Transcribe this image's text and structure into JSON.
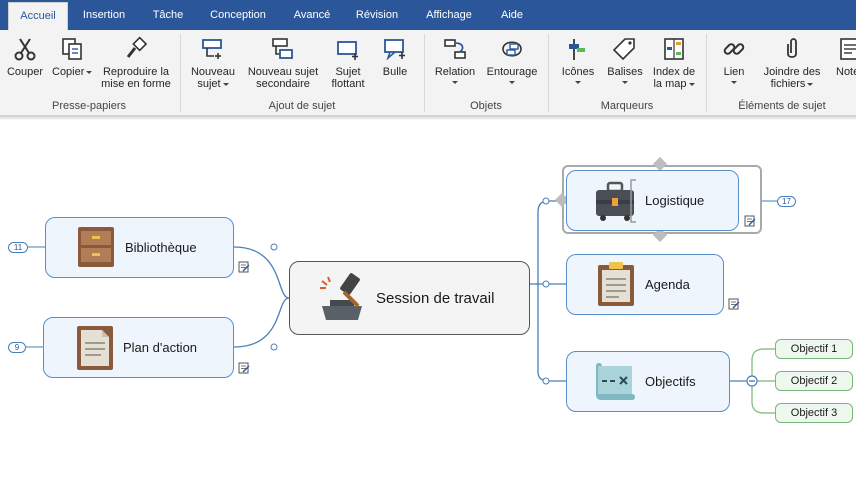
{
  "tabs": [
    {
      "label": "Accueil",
      "active": true
    },
    {
      "label": "Insertion",
      "active": false
    },
    {
      "label": "Tâche",
      "active": false
    },
    {
      "label": "Conception",
      "active": false
    },
    {
      "label": "Avancé",
      "active": false
    },
    {
      "label": "Révision",
      "active": false
    },
    {
      "label": "Affichage",
      "active": false
    },
    {
      "label": "Aide",
      "active": false
    }
  ],
  "ribbon": {
    "buttons": {
      "couper": "Couper",
      "copier": "Copier",
      "reproduire_1": "Reproduire la",
      "reproduire_2": "mise en forme",
      "nouveau_sujet_1": "Nouveau",
      "nouveau_sujet_2": "sujet",
      "sujet_secondaire_1": "Nouveau sujet",
      "sujet_secondaire_2": "secondaire",
      "sujet_flottant_1": "Sujet",
      "sujet_flottant_2": "flottant",
      "bulle": "Bulle",
      "relation": "Relation",
      "entourage": "Entourage",
      "icones": "Icônes",
      "balises": "Balises",
      "index_1": "Index de",
      "index_2": "la map",
      "lien": "Lien",
      "joindre_1": "Joindre des",
      "joindre_2": "fichiers",
      "notes": "Note"
    },
    "groups": {
      "presse_papiers": "Presse-papiers",
      "ajout_sujet": "Ajout de sujet",
      "objets": "Objets",
      "marqueurs": "Marqueurs",
      "elements_sujet": "Éléments de sujet"
    }
  },
  "map": {
    "central": {
      "label": "Session de travail",
      "icon": "gavel-icon"
    },
    "left_topics": [
      {
        "label": "Bibliothèque",
        "icon": "cabinet-icon",
        "count": "11"
      },
      {
        "label": "Plan d'action",
        "icon": "document-icon",
        "count": "9"
      }
    ],
    "right_topics": [
      {
        "label": "Logistique",
        "icon": "briefcase-icon",
        "count": "17"
      },
      {
        "label": "Agenda",
        "icon": "clipboard-icon"
      },
      {
        "label": "Objectifs",
        "icon": "scroll-icon"
      }
    ],
    "subtopics": [
      "Objectif 1",
      "Objectif 2",
      "Objectif 3"
    ]
  },
  "colors": {
    "tab_bar": "#2b579a",
    "ribbon_bg": "#f3f3f3",
    "topic_border": "#5a8fc7",
    "topic_fill": "#eef5fc",
    "subtopic_border": "#79b879",
    "subtopic_fill": "#eef8ee"
  }
}
